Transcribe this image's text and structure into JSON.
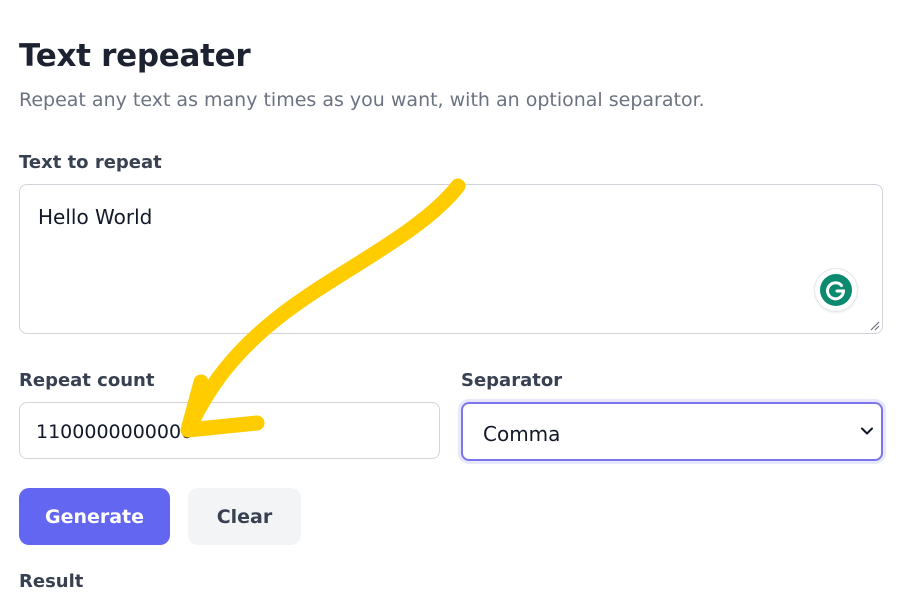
{
  "header": {
    "title": "Text repeater",
    "subtitle": "Repeat any text as many times as you want, with an optional separator."
  },
  "text_field": {
    "label": "Text to repeat",
    "value": "Hello World"
  },
  "repeat_count": {
    "label": "Repeat count",
    "value": "1100000000000"
  },
  "separator": {
    "label": "Separator",
    "selected": "Comma"
  },
  "buttons": {
    "generate": "Generate",
    "clear": "Clear"
  },
  "result": {
    "label": "Result"
  },
  "icons": {
    "grammarly": "grammarly-icon",
    "chevron": "chevron-down-icon",
    "resize": "resize-handle-icon",
    "annotation": "yellow-arrow-annotation"
  },
  "colors": {
    "accent": "#6366f1",
    "annotation": "#ffcc00",
    "grammarly": "#0b8a6f"
  }
}
